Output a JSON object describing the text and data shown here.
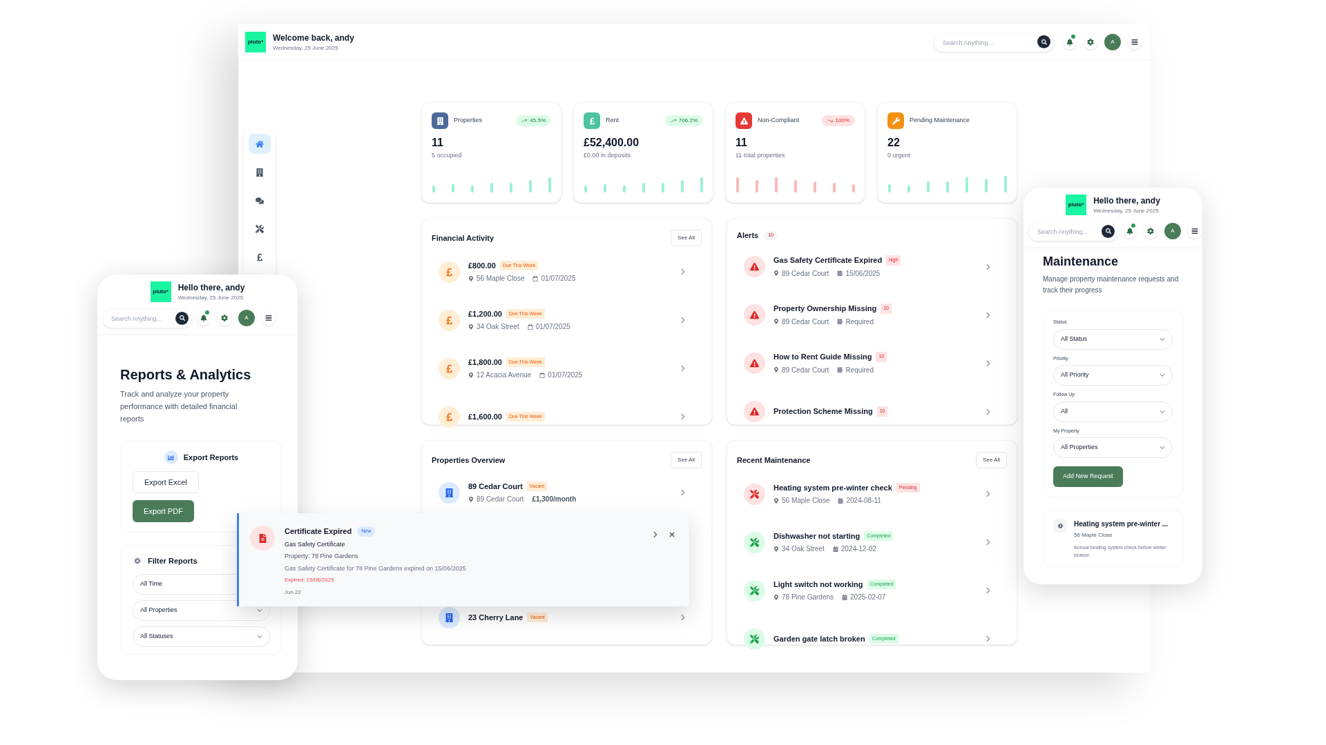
{
  "header": {
    "logo": "pluto*",
    "title": "Welcome back, andy",
    "date": "Wednesday, 25 June 2025",
    "search": {
      "placeholder": "Search Anything..."
    },
    "avatar": "A"
  },
  "sidebar": {
    "items": [
      {
        "selected": true
      },
      {
        "selected": false
      },
      {
        "selected": false
      },
      {
        "selected": false
      },
      {
        "selected": false
      }
    ]
  },
  "stats": [
    {
      "label": "Properties",
      "change": "45.5%",
      "rising": true,
      "value": "11",
      "note": "5 occupied",
      "color": "#4b6a9b"
    },
    {
      "label": "Rent",
      "change": "706.2%",
      "rising": true,
      "value": "£52,400.00",
      "note": "£0.00 in deposits",
      "color": "#4fc3a1"
    },
    {
      "label": "Non-Compliant",
      "change": "100%",
      "rising": false,
      "value": "11",
      "note": "11 total properties",
      "color": "#e53935"
    },
    {
      "label": "Pending Maintenance",
      "rising": true,
      "value": "22",
      "note": "0 urgent",
      "color": "#f29111"
    }
  ],
  "financial": {
    "title": "Financial Activity",
    "see_all": "See All",
    "items": [
      {
        "amount": "£800.00",
        "badge": "Due This Week",
        "address": "56 Maple Close",
        "date": "01/07/2025"
      },
      {
        "amount": "£1,200.00",
        "badge": "Due This Week",
        "address": "34 Oak Street",
        "date": "01/07/2025"
      },
      {
        "amount": "£1,800.00",
        "badge": "Due This Week",
        "address": "12 Acacia Avenue",
        "date": "01/07/2025"
      },
      {
        "amount": "£1,600.00",
        "badge": "Due This Week"
      }
    ]
  },
  "alerts": {
    "title": "Alerts",
    "count": "10",
    "items": [
      {
        "title": "Gas Safety Certificate Expired",
        "badge": "high",
        "address": "89 Cedar Court",
        "detail": "15/06/2025"
      },
      {
        "title": "Property Ownership Missing",
        "badge": "10",
        "address": "89 Cedar Court",
        "detail": "Required"
      },
      {
        "title": "How to Rent Guide Missing",
        "badge": "10",
        "address": "89 Cedar Court",
        "detail": "Required"
      },
      {
        "title": "Protection Scheme Missing",
        "badge": "10"
      }
    ]
  },
  "properties": {
    "title": "Properties Overview",
    "see_all": "See All",
    "items": [
      {
        "name": "89 Cedar Court",
        "badge": "Vacant",
        "address": "89 Cedar Court",
        "rent": "£1,300/month"
      },
      {
        "name": "23 Cherry Lane",
        "badge": "Vacant"
      }
    ]
  },
  "maintenance": {
    "title": "Recent Maintenance",
    "see_all": "See All",
    "items": [
      {
        "title": "Heating system pre-winter check",
        "status": "Pending",
        "kind": "pending",
        "address": "56 Maple Close",
        "date": "2024-08-11"
      },
      {
        "title": "Dishwasher not starting",
        "status": "Completed",
        "kind": "completed",
        "address": "34 Oak Street",
        "date": "2024-12-02"
      },
      {
        "title": "Light switch not working",
        "status": "Completed",
        "kind": "completed",
        "address": "78 Pine Gardens",
        "date": "2025-02-07"
      },
      {
        "title": "Garden gate latch broken",
        "status": "Completed",
        "kind": "completed"
      }
    ]
  },
  "toast": {
    "title": "Certificate Expired",
    "badge": "New",
    "subtitle": "Gas Safety Certificate",
    "property": "Property: 78 Pine Gardens",
    "message": "Gas Safety Certificate for 78 Pine Gardens expired on 15/06/2025",
    "expired": "Expired: 15/06/2025",
    "time": "Jun 22"
  },
  "reports_phone": {
    "logo": "pluto*",
    "greeting": "Hello there, andy",
    "date": "Wednesday, 25 June 2025",
    "search": {
      "placeholder": "Search Anything..."
    },
    "avatar": "A",
    "title": "Reports & Analytics",
    "description": "Track and analyze your property performance with detailed financial reports",
    "export": {
      "title": "Export Reports",
      "buttons": [
        {
          "label": "Export Excel",
          "primary": false
        },
        {
          "label": "Export PDF",
          "primary": true
        }
      ]
    },
    "filters": {
      "title": "Filter Reports",
      "selects": [
        "All Time",
        "All Properties",
        "All Statuses"
      ]
    }
  },
  "maintenance_phone": {
    "logo": "pluto*",
    "greeting": "Hello there, andy",
    "date": "Wednesday, 25 June 2025",
    "search": {
      "placeholder": "Search Anything..."
    },
    "avatar": "A",
    "title": "Maintenance",
    "description": "Manage property maintenance requests and track their progress",
    "filters": [
      {
        "label": "Status",
        "value": "All Status"
      },
      {
        "label": "Priority",
        "value": "All Priority"
      },
      {
        "label": "Follow Up",
        "value": "All"
      },
      {
        "label": "My Property",
        "value": "All Properties"
      }
    ],
    "button": "Add New Request",
    "request": {
      "title": "Heating system pre-winter ...",
      "address": "56 Maple Close",
      "description": "Annual heating system check before winter season"
    }
  }
}
